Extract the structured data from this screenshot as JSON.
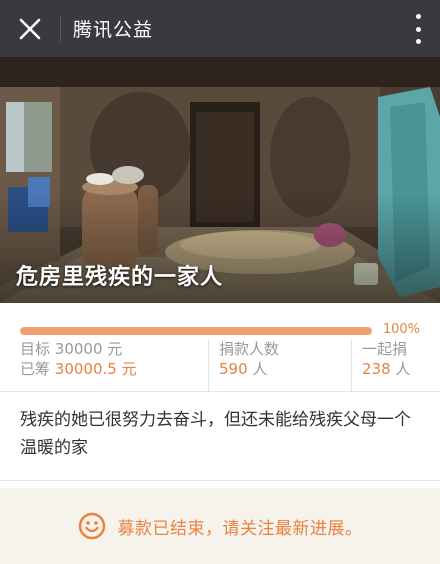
{
  "header": {
    "title": "腾讯公益",
    "close_icon": "close-icon",
    "more_icon": "more-vertical-icon"
  },
  "hero": {
    "title": "危房里残疾的一家人"
  },
  "progress": {
    "percent_label": "100%",
    "fraction": 1.0
  },
  "stats": {
    "target_label": "目标",
    "target_value": "30000 元",
    "raised_label": "已筹",
    "raised_value": "30000.5 元",
    "donors_label": "捐款人数",
    "donors_value": "590",
    "donors_unit": "人",
    "together_label": "一起捐",
    "together_value": "238",
    "together_unit": "人"
  },
  "description": "残疾的她已很努力去奋斗，但还未能给残疾父母一个温暖的家",
  "footer": {
    "status_text": "募款已结束，请关注最新进展。",
    "icon": "smile-icon"
  },
  "colors": {
    "accent": "#e8823f",
    "navbar": "#393a3f",
    "progress_track": "#f2dccb"
  }
}
